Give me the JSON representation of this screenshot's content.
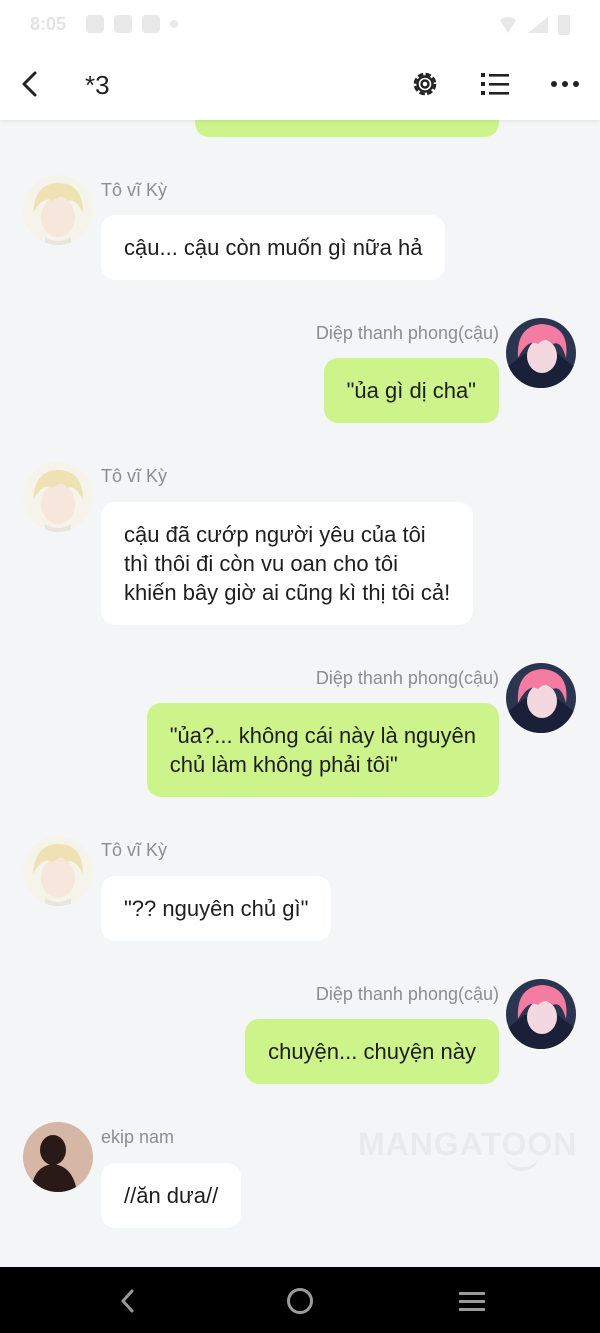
{
  "status_bar": {
    "time": "8:05"
  },
  "header": {
    "title": "*3"
  },
  "messages": [
    {
      "name": "Tô vĩ Kỳ",
      "text": "cậu... cậu còn muốn gì nữa hả"
    },
    {
      "name": "Diệp thanh phong(cậu)",
      "text": "\"ủa gì dị cha\""
    },
    {
      "name": "Tô vĩ Kỳ",
      "lines": [
        "cậu đã cướp người yêu của tôi",
        "thì thôi đi còn vu oan cho tôi",
        "khiến bây giờ ai cũng kì thị tôi cả!"
      ]
    },
    {
      "name": "Diệp thanh phong(cậu)",
      "lines": [
        "\"ủa?... không cái này là nguyên",
        "chủ làm không phải tôi\""
      ]
    },
    {
      "name": "Tô vĩ Kỳ",
      "text": "\"?? nguyên chủ gì\""
    },
    {
      "name": "Diệp thanh phong(cậu)",
      "text": "chuyện... chuyện này"
    },
    {
      "name": "ekip nam",
      "text": "//ăn dưa//"
    }
  ],
  "watermark": "MANGATOON",
  "colors": {
    "right_bubble": "#cdf38b",
    "left_bubble": "#ffffff",
    "background": "#f4f5f7"
  },
  "icons": [
    "back-arrow-icon",
    "gear-icon",
    "list-icon",
    "more-icon",
    "nav-back-icon",
    "nav-home-icon",
    "nav-menu-icon"
  ]
}
